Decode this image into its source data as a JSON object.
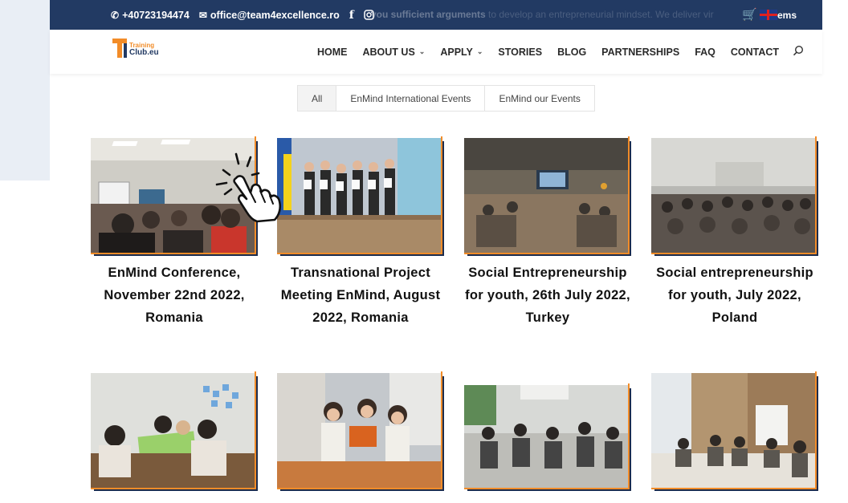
{
  "topbar": {
    "phone": "+40723194474",
    "email": "office@team4excellence.ro",
    "ghost_text_bold": "you sufficient arguments",
    "ghost_text": " to develop an entrepreneurial mindset. We deliver vir",
    "tail_text": "ems"
  },
  "logo": {
    "line1": "Training",
    "line2": "Club.eu"
  },
  "nav": {
    "items": [
      {
        "label": "HOME",
        "dropdown": false
      },
      {
        "label": "ABOUT US",
        "dropdown": true
      },
      {
        "label": "APPLY",
        "dropdown": true
      },
      {
        "label": "STORIES",
        "dropdown": false
      },
      {
        "label": "BLOG",
        "dropdown": false
      },
      {
        "label": "PARTNERSHIPS",
        "dropdown": false
      },
      {
        "label": "FAQ",
        "dropdown": false
      },
      {
        "label": "CONTACT",
        "dropdown": false
      }
    ]
  },
  "filters": [
    "All",
    "EnMind International Events",
    "EnMind our Events"
  ],
  "gallery": [
    {
      "title": "EnMind Conference, November 22nd 2022, Romania"
    },
    {
      "title": "Transnational Project Meeting EnMind, August 2022, Romania"
    },
    {
      "title": "Social Entrepreneurship for youth, 26th July 2022, Turkey"
    },
    {
      "title": "Social entrepreneurship for youth, July 2022, Poland"
    },
    {
      "title": ""
    },
    {
      "title": ""
    },
    {
      "title": ""
    },
    {
      "title": ""
    }
  ],
  "colors": {
    "navy": "#223a63",
    "accent": "#f28c28"
  },
  "icons": [
    "phone-icon",
    "mail-icon",
    "facebook-icon",
    "instagram-icon",
    "cart-icon",
    "uk-flag-icon",
    "search-icon",
    "hand-pointer-icon"
  ]
}
